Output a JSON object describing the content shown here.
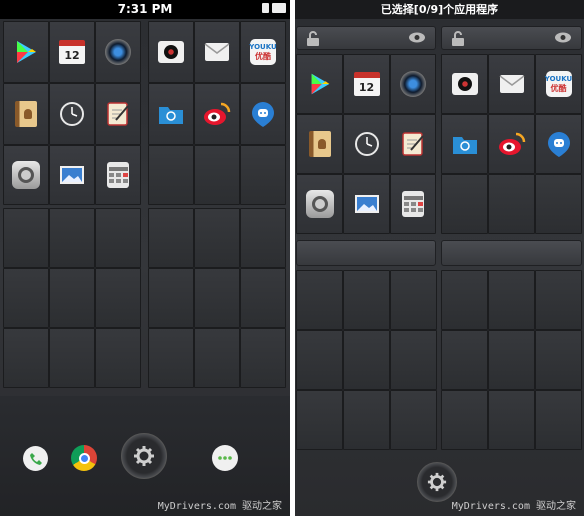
{
  "left_screen": {
    "status_bar": {
      "time": "7:31 PM"
    },
    "folder_apps": [
      "Play Store",
      "Calendar",
      "Camera",
      "Music",
      "Mail",
      "Youku",
      "Contacts",
      "Clock",
      "Notes",
      "Files",
      "Weibo",
      "Messenger",
      "Settings",
      "Gallery",
      "Calculator"
    ],
    "calendar_date": "12",
    "youku_label_top": "YOUKU",
    "youku_label_bottom": "优酷",
    "dock_apps": [
      "Phone",
      "Chrome",
      "Settings",
      "Messages"
    ],
    "watermark": "MyDrivers.com 驱动之家"
  },
  "right_screen": {
    "title": "已选择[0/9]个应用程序",
    "calendar_date": "12",
    "youku_label_top": "YOUKU",
    "youku_label_bottom": "优酷",
    "watermark": "MyDrivers.com 驱动之家"
  },
  "colors": {
    "background": "#2f3135",
    "status_bar": "#000000",
    "accent_blue": "#2a8fd6"
  }
}
